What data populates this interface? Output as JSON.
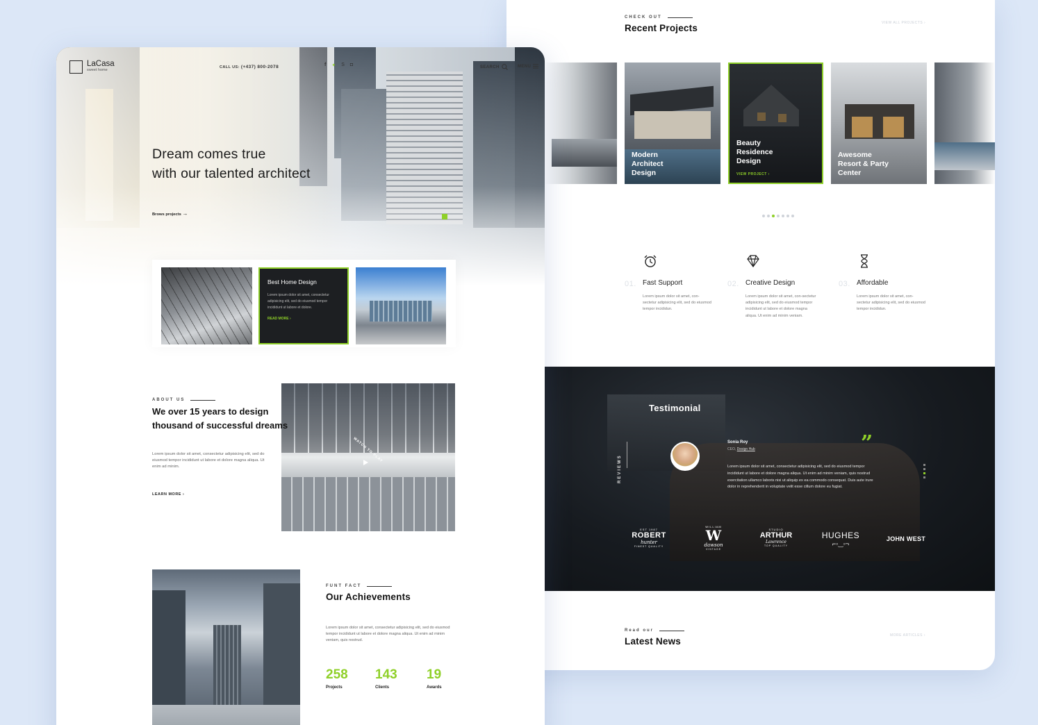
{
  "colors": {
    "accent": "#8fd028",
    "background": "#dce7f7",
    "dark": "#161a1f"
  },
  "right": {
    "recent": {
      "eyebrow": "CHECK OUT",
      "title": "Recent Projects",
      "view_all": "VIEW ALL PROJECTS"
    },
    "projects": [
      {
        "caption": "Modern\nArchitect\nDesign"
      },
      {
        "caption": "Beauty\nResidence\nDesign",
        "link": "VIEW PROJECT"
      },
      {
        "caption": "Awesome\nResort & Party\nCenter"
      }
    ],
    "features": [
      {
        "num": "01.",
        "title": "Fast Support",
        "desc": "Lorem ipsum dolor sit amet, con-sectetur adipisicing elit, sed do eiusmod tempor incididun.",
        "icon": "alarm-clock-icon"
      },
      {
        "num": "02.",
        "title": "Creative Design",
        "desc": "Lorem ipsum dolor sit amet, con-sectetur adipisicing elit, sed do eiusmod tempor incididunt ut labore et dolore magna aliqua. Ut enim ad minim veniam.",
        "icon": "diamond-icon"
      },
      {
        "num": "03.",
        "title": "Affordable",
        "desc": "Lorem ipsum dolor sit amet, con-sectetur adipisicing elit, sed do eiusmod tempor incididun.",
        "icon": "hourglass-icon"
      }
    ],
    "testimonial": {
      "title": "Testimonial",
      "side_label": "REVIEWS",
      "name": "Sonia Roy",
      "role_prefix": "CEO,",
      "company": "Design Hub",
      "quote": "Lorem ipsum dolor sit amet, consectetur adipisicing elit, sed do eiusmod tempor incididunt ut labore et dolore magna aliqua. Ut enim ad minim veniam, quis nostrud exercitation ullamco laboris nisi ut aliquip ex ea commodo consequat. Duis aute irure dolor in reprehenderit in voluptate velit esse cillum dolore eu fugiat.",
      "logos": [
        {
          "main": "ROBERT",
          "sub": "hunter",
          "top": "EST 1987",
          "bottom": "FINEST QUALITY"
        },
        {
          "main": "W",
          "sub": "dawson",
          "top": "WILLIAM",
          "bottom": "VINTAGE"
        },
        {
          "main": "ARTHUR",
          "sub": "Lawrence",
          "top": "STUDIO",
          "bottom": "TOP QUALITY"
        },
        {
          "main": "HUGHES",
          "sub": "",
          "top": "",
          "bottom": ""
        },
        {
          "main": "JOHN WEST",
          "sub": "",
          "top": "",
          "bottom": ""
        }
      ]
    },
    "news": {
      "eyebrow": "Read our",
      "title": "Latest News",
      "more": "MORE ARTICLES"
    }
  },
  "left": {
    "logo": {
      "name": "LaCasa",
      "tagline": "sweet home"
    },
    "nav": {
      "call_label": "CALL US:",
      "phone": "(+437) 800-2078",
      "search": "SEARCH",
      "menu": "MENU"
    },
    "hero": {
      "line1": "Dream comes true",
      "line2": "with our talented architect",
      "browse": "Brows projects"
    },
    "service_card": {
      "title": "Best Home Design",
      "desc": "Lorem ipsum dolor sit amet, consectetur adipisicing elit, sed do eiusmod tempor incididunt ut labore et dolore.",
      "link": "READ MORE"
    },
    "about": {
      "eyebrow": "ABOUT US",
      "title_line1": "We  over 15 years to design",
      "title_line2": "thousand of successful dreams",
      "desc": "Lorem ipsum dolor sit amet, consectetur adipisicing elit, sed do eiusmod tempor incididunt ut labore et dolore magna aliqua. Ut enim ad minim.",
      "link": "LEARN MORE",
      "watch": "WATCH TO PLAY"
    },
    "achievements": {
      "eyebrow": "FUNT FACT",
      "title": "Our Achievements",
      "desc": "Lorem ipsum dolor sit amet, consectetur adipisicing elit, sed do eiusmod tempor incididunt ut labore et dolore magna aliqua. Ut enim ad minim veniam, quis nostrud.",
      "stats": [
        {
          "value": "258",
          "label": "Projects"
        },
        {
          "value": "143",
          "label": "Clients"
        },
        {
          "value": "19",
          "label": "Awards"
        }
      ]
    }
  }
}
